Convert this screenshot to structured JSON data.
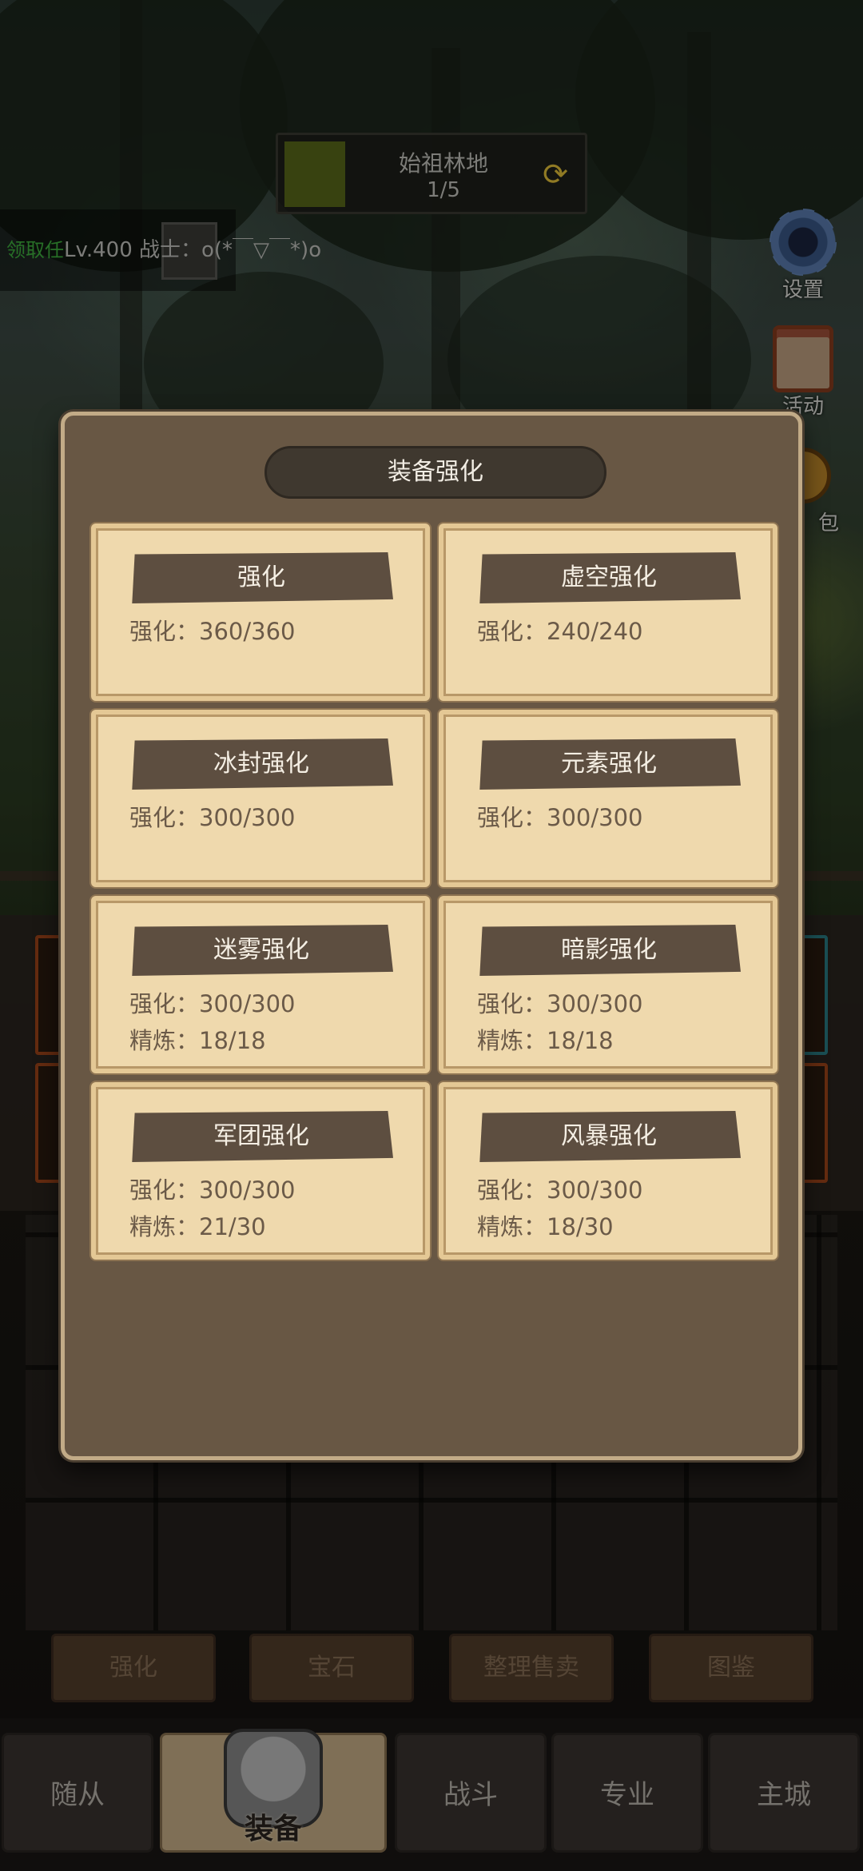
{
  "hud": {
    "stage_name": "始祖林地",
    "stage_progress": "1/5",
    "task_prefix": "领取任",
    "task_text": "Lv.400 战士：o(*￣▽￣*)o"
  },
  "side_buttons": {
    "settings": "设置",
    "activity": "活动",
    "bag": "包"
  },
  "function_buttons": [
    "强化",
    "宝石",
    "整理售卖",
    "图鉴"
  ],
  "nav": {
    "followers": "随从",
    "equipment": "装备",
    "battle": "战斗",
    "profession": "专业",
    "main_city": "主城"
  },
  "modal": {
    "title": "装备强化",
    "cards": [
      {
        "name": "强化",
        "enhance_label": "强化：",
        "enhance_value": "360/360"
      },
      {
        "name": "虚空强化",
        "enhance_label": "强化：",
        "enhance_value": "240/240"
      },
      {
        "name": "冰封强化",
        "enhance_label": "强化：",
        "enhance_value": "300/300"
      },
      {
        "name": "元素强化",
        "enhance_label": "强化：",
        "enhance_value": "300/300"
      },
      {
        "name": "迷雾强化",
        "enhance_label": "强化：",
        "enhance_value": "300/300",
        "refine_label": "精炼：",
        "refine_value": "18/18"
      },
      {
        "name": "暗影强化",
        "enhance_label": "强化：",
        "enhance_value": "300/300",
        "refine_label": "精炼：",
        "refine_value": "18/18"
      },
      {
        "name": "军团强化",
        "enhance_label": "强化：",
        "enhance_value": "300/300",
        "refine_label": "精炼：",
        "refine_value": "21/30"
      },
      {
        "name": "风暴强化",
        "enhance_label": "强化：",
        "enhance_value": "300/300",
        "refine_label": "精炼：",
        "refine_value": "18/30"
      }
    ]
  },
  "colors": {
    "modal_bg": "#685744",
    "card_bg": "#efd9ad",
    "card_header": "#5d4e40",
    "card_text": "#6b5a48",
    "stage_refresh": "#e8c63a",
    "task_green": "#3fb33f"
  },
  "icons": [
    "refresh-icon",
    "settings-gear-icon",
    "activity-scroll-icon",
    "bag-coin-icon",
    "armor-icon"
  ]
}
